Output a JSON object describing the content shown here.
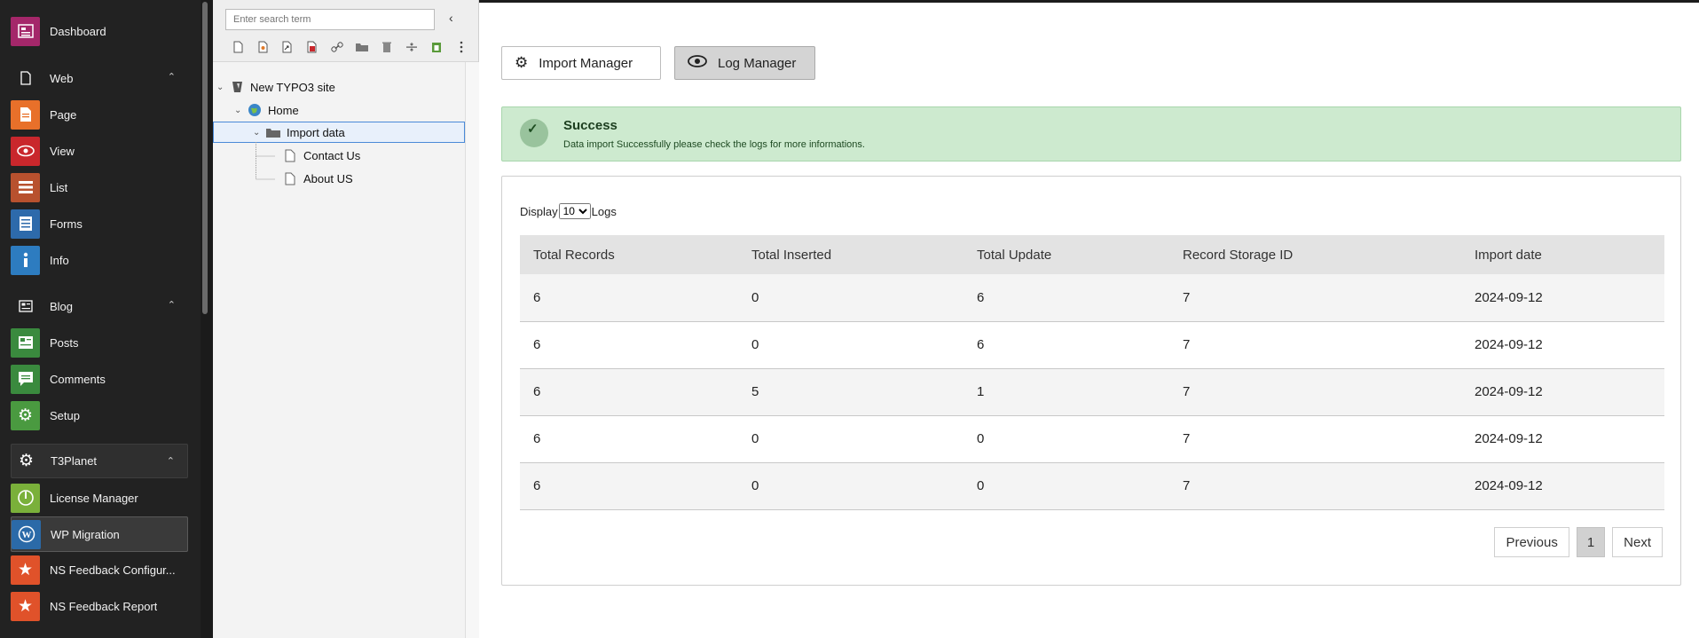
{
  "menu": {
    "items": [
      {
        "label": "Dashboard",
        "color": "#a4276a",
        "icon": "dashboard-icon"
      },
      {
        "label": "Web",
        "group": true,
        "icon": "page-outline-icon"
      },
      {
        "label": "Page",
        "color": "#e8702a",
        "icon": "page-icon"
      },
      {
        "label": "View",
        "color": "#c9272c",
        "icon": "eye-icon"
      },
      {
        "label": "List",
        "color": "#b8512e",
        "icon": "list-icon"
      },
      {
        "label": "Forms",
        "color": "#2d6aab",
        "icon": "forms-icon"
      },
      {
        "label": "Info",
        "color": "#2d7cc0",
        "icon": "info-icon"
      },
      {
        "label": "Blog",
        "group": true,
        "icon": "newspaper-icon"
      },
      {
        "label": "Posts",
        "color": "#3a8a3e",
        "icon": "posts-icon"
      },
      {
        "label": "Comments",
        "color": "#3a8a3e",
        "icon": "comments-icon"
      },
      {
        "label": "Setup",
        "color": "#4a9a40",
        "icon": "gear-icon"
      },
      {
        "label": "T3Planet",
        "group": true,
        "icon": "gear-icon"
      },
      {
        "label": "License Manager",
        "color": "#7ab03a",
        "icon": "power-icon"
      },
      {
        "label": "WP Migration",
        "color": "#2b6aa8",
        "icon": "wordpress-icon"
      },
      {
        "label": "NS Feedback Configur...",
        "color": "#e0522a",
        "icon": "star-icon"
      },
      {
        "label": "NS Feedback Report",
        "color": "#e0522a",
        "icon": "star-icon"
      }
    ]
  },
  "tree": {
    "search_placeholder": "Enter search term",
    "root": "New TYPO3 site",
    "home": "Home",
    "selected": "Import data",
    "children": [
      "Contact Us",
      "About US"
    ]
  },
  "buttons": {
    "import_manager": "Import Manager",
    "log_manager": "Log Manager"
  },
  "alert": {
    "title": "Success",
    "message": "Data import Successfully please check the logs for more informations."
  },
  "logs": {
    "display_prefix": "Display",
    "display_suffix": "Logs",
    "page_size": "10",
    "headers": [
      "Total Records",
      "Total Inserted",
      "Total Update",
      "Record Storage ID",
      "Import date"
    ],
    "rows": [
      [
        "6",
        "0",
        "6",
        "7",
        "2024-09-12"
      ],
      [
        "6",
        "0",
        "6",
        "7",
        "2024-09-12"
      ],
      [
        "6",
        "5",
        "1",
        "7",
        "2024-09-12"
      ],
      [
        "6",
        "0",
        "0",
        "7",
        "2024-09-12"
      ],
      [
        "6",
        "0",
        "0",
        "7",
        "2024-09-12"
      ]
    ]
  },
  "pager": {
    "previous": "Previous",
    "current": "1",
    "next": "Next"
  }
}
